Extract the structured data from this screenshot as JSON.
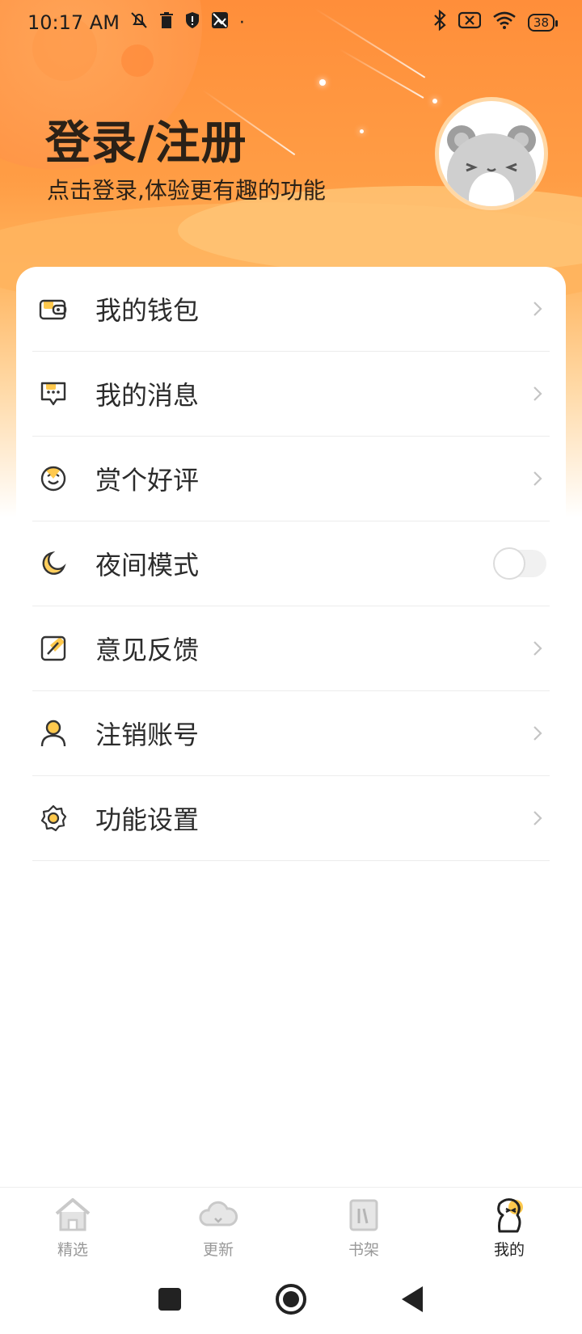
{
  "status_bar": {
    "time": "10:17 AM",
    "battery": "38"
  },
  "header": {
    "title": "登录/注册",
    "subtitle": "点击登录,体验更有趣的功能"
  },
  "menu": {
    "items": [
      {
        "label": "我的钱包",
        "icon": "wallet-icon"
      },
      {
        "label": "我的消息",
        "icon": "message-icon"
      },
      {
        "label": "赏个好评",
        "icon": "smile-icon"
      },
      {
        "label": "夜间模式",
        "icon": "moon-icon",
        "toggle": false
      },
      {
        "label": "意见反馈",
        "icon": "feedback-icon"
      },
      {
        "label": "注销账号",
        "icon": "user-icon"
      },
      {
        "label": "功能设置",
        "icon": "gear-icon"
      }
    ]
  },
  "tabs": [
    {
      "label": "精选",
      "icon": "home-icon",
      "active": false
    },
    {
      "label": "更新",
      "icon": "cloud-icon",
      "active": false
    },
    {
      "label": "书架",
      "icon": "bookshelf-icon",
      "active": false
    },
    {
      "label": "我的",
      "icon": "mine-icon",
      "active": true
    }
  ],
  "colors": {
    "accent": "#ff9a44",
    "icon_fill": "#ffc94d",
    "text_dark": "#2b2117"
  }
}
